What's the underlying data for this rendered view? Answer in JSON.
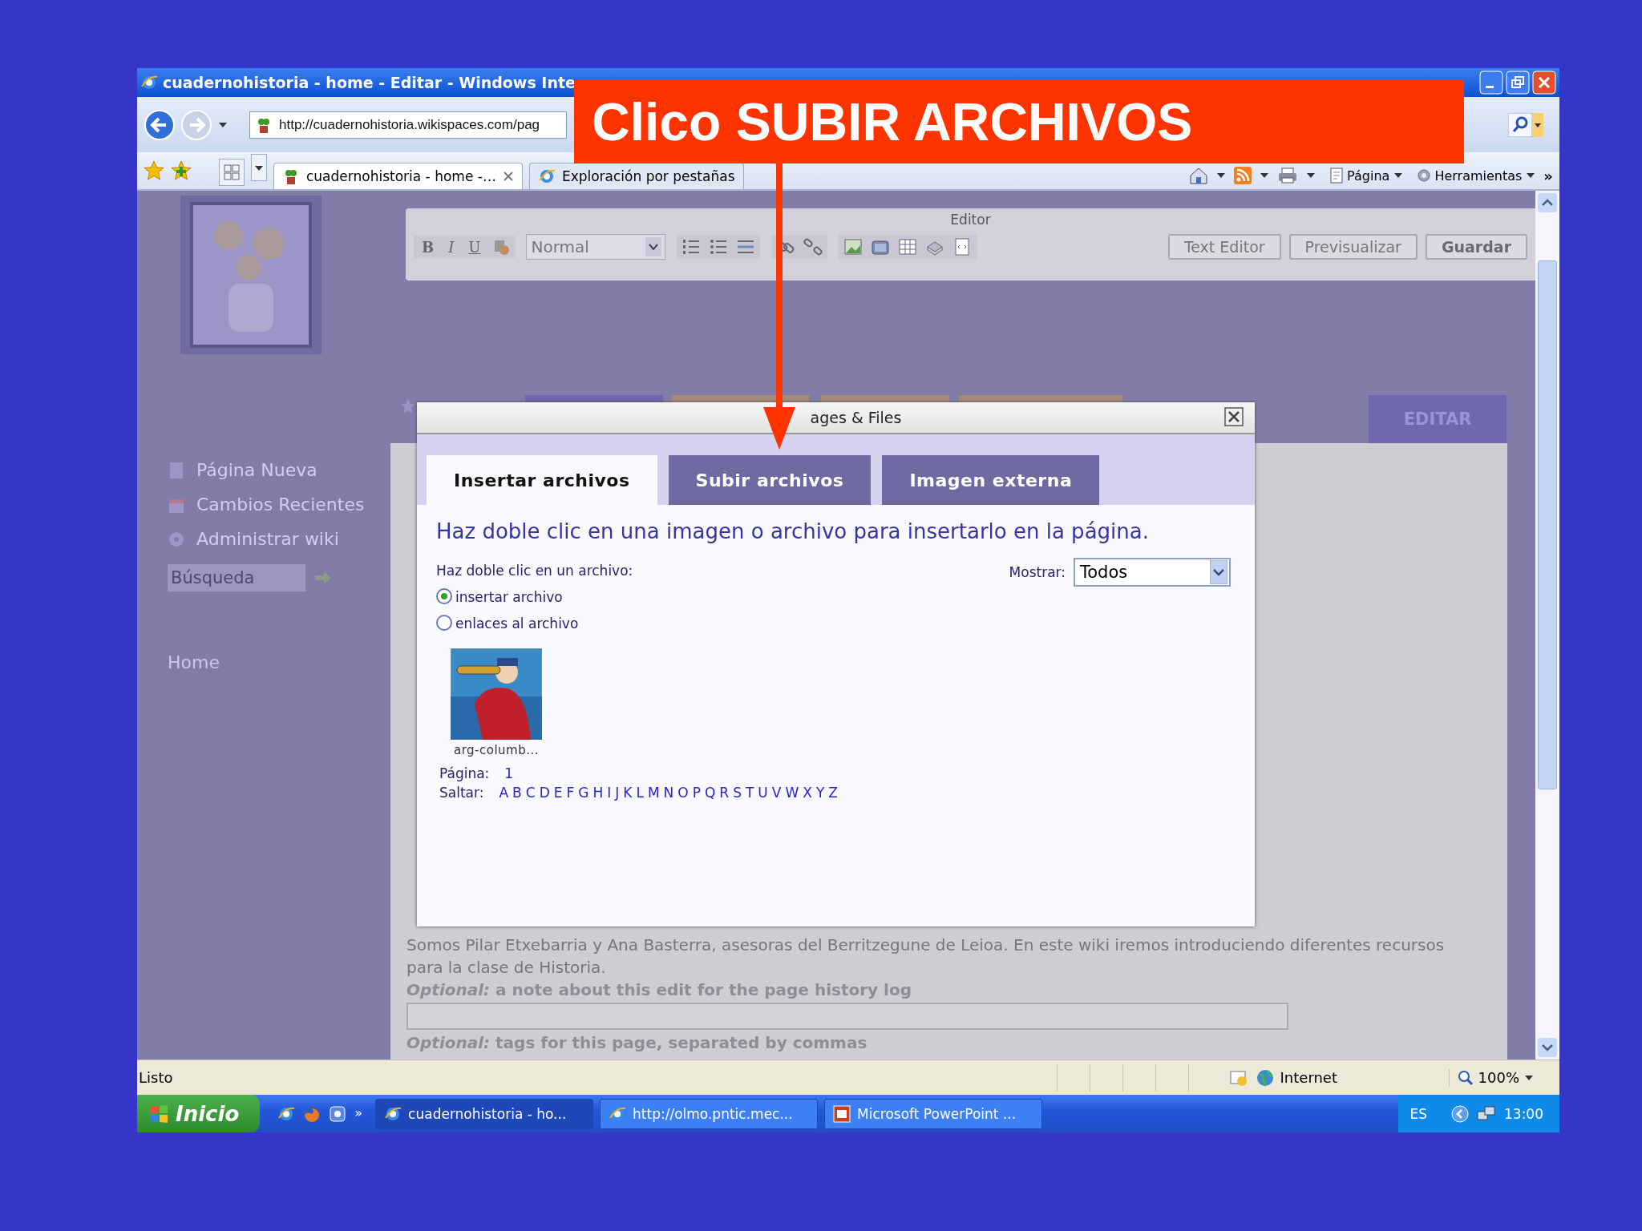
{
  "callout": {
    "text": "Clico SUBIR ARCHIVOS"
  },
  "window": {
    "title": "cuadernohistoria - home - Editar - Windows Inte",
    "address": "http://cuadernohistoria.wikispaces.com/pag",
    "tabs": [
      {
        "label": "cuadernohistoria - home -…",
        "selected": true
      },
      {
        "label": "Exploración por pestañas",
        "selected": false
      }
    ],
    "command_bar": [
      "Página",
      "Herramientas"
    ],
    "more": "»"
  },
  "page": {
    "editor": {
      "title": "Editor",
      "format_buttons": [
        "B",
        "I",
        "U"
      ],
      "style": "Normal",
      "buttons": [
        "Text Editor",
        "Previsualizar",
        "Guardar"
      ]
    },
    "nav_tabs": [
      {
        "selected": true
      },
      {
        "selected": false
      },
      {
        "selected": false
      },
      {
        "selected": false
      }
    ],
    "edit_tab": "EDITAR",
    "sidebar": {
      "items": [
        "Página Nueva",
        "Cambios Recientes",
        "Administrar wiki"
      ],
      "search_placeholder": "Búsqueda",
      "home": "Home"
    },
    "body": [
      "Somos Pilar Etxebarria y Ana Basterra, asesoras del Berritzegune de Leioa. En este wiki iremos introduciendo diferentes recursos",
      "para la clase de Historia."
    ],
    "note_label": "*Optional:* a note about this edit for the page history log",
    "tags_label": "*Optional:* tags for this page, separated by commas"
  },
  "dialog": {
    "title": "ages & Files",
    "tabs": [
      {
        "label": "Insertar archivos",
        "selected": true
      },
      {
        "label": "Subir archivos",
        "selected": false
      },
      {
        "label": "Imagen externa",
        "selected": false
      }
    ],
    "heading": "Haz doble clic en una imagen o archivo para insertarlo en la página.",
    "prompt": "Haz doble clic en un archivo:",
    "options": [
      {
        "label": "insertar archivo",
        "selected": true
      },
      {
        "label": "enlaces al archivo",
        "selected": false
      }
    ],
    "show_label": "Mostrar:",
    "show_value": "Todos",
    "file": {
      "caption": "arg-columb..."
    },
    "page_label": "Página:",
    "pages": [
      "1"
    ],
    "jump_label": "Saltar:",
    "letters": [
      "A",
      "B",
      "C",
      "D",
      "E",
      "F",
      "G",
      "H",
      "I",
      "J",
      "K",
      "L",
      "M",
      "N",
      "O",
      "P",
      "Q",
      "R",
      "S",
      "T",
      "U",
      "V",
      "W",
      "X",
      "Y",
      "Z"
    ]
  },
  "status_bar": {
    "text": "Listo",
    "zone": "Internet",
    "zoom": "100%"
  },
  "taskbar": {
    "start": "Inicio",
    "more": "»",
    "tasks": [
      {
        "label": "cuadernohistoria - ho...",
        "selected": true
      },
      {
        "label": "http://olmo.pntic.mec...",
        "selected": false
      },
      {
        "label": "Microsoft PowerPoint ...",
        "selected": false
      }
    ],
    "language": "ES",
    "time": "13:00"
  }
}
